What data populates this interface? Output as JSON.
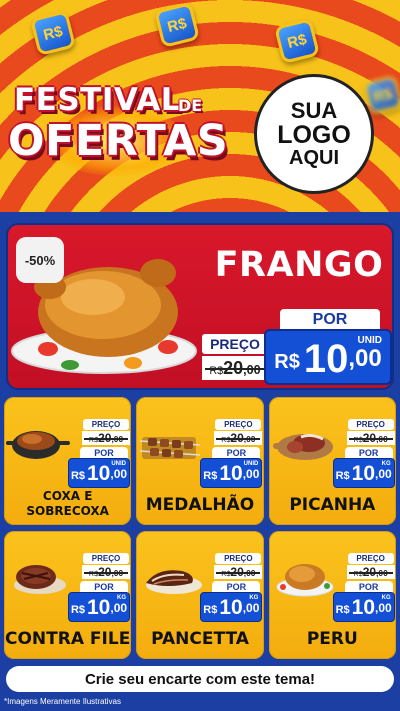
{
  "header": {
    "currency_symbol": "R$",
    "title_line1": "FESTIVAL",
    "title_connector": "DE",
    "title_line2": "OFERTAS",
    "logo": {
      "line1": "SUA",
      "line2": "LOGO",
      "line3": "AQUI"
    }
  },
  "featured": {
    "discount": "-50%",
    "name": "FRANGO",
    "preco_label": "PREÇO",
    "old_currency": "R$",
    "old_integer": "20",
    "old_cents": ",00",
    "por_label": "POR",
    "new_currency": "R$",
    "new_integer": "10",
    "new_cents": ",00",
    "unit": "UNID"
  },
  "products": [
    {
      "name": "COXA E SOBRECOXA",
      "preco_label": "PREÇO",
      "old_currency": "R$",
      "old_integer": "20",
      "old_cents": ",00",
      "por_label": "POR",
      "new_currency": "R$",
      "new_integer": "10",
      "new_cents": ",00",
      "unit": "UNID"
    },
    {
      "name": "MEDALHÃO",
      "preco_label": "PREÇO",
      "old_currency": "R$",
      "old_integer": "20",
      "old_cents": ",00",
      "por_label": "POR",
      "new_currency": "R$",
      "new_integer": "10",
      "new_cents": ",00",
      "unit": "UNID"
    },
    {
      "name": "PICANHA",
      "preco_label": "PREÇO",
      "old_currency": "R$",
      "old_integer": "20",
      "old_cents": ",00",
      "por_label": "POR",
      "new_currency": "R$",
      "new_integer": "10",
      "new_cents": ",00",
      "unit": "KG"
    },
    {
      "name": "CONTRA FILE",
      "preco_label": "PREÇO",
      "old_currency": "R$",
      "old_integer": "20",
      "old_cents": ",00",
      "por_label": "POR",
      "new_currency": "R$",
      "new_integer": "10",
      "new_cents": ",00",
      "unit": "KG"
    },
    {
      "name": "PANCETTA",
      "preco_label": "PREÇO",
      "old_currency": "R$",
      "old_integer": "20",
      "old_cents": ",00",
      "por_label": "POR",
      "new_currency": "R$",
      "new_integer": "10",
      "new_cents": ",00",
      "unit": "KG"
    },
    {
      "name": "PERU",
      "preco_label": "PREÇO",
      "old_currency": "R$",
      "old_integer": "20",
      "old_cents": ",00",
      "por_label": "POR",
      "new_currency": "R$",
      "new_integer": "10",
      "new_cents": ",00",
      "unit": "KG"
    }
  ],
  "cta": {
    "text": "Crie seu encarte com este tema!"
  },
  "disclaimer": "*Imagens Meramente Ilustrativas",
  "colors": {
    "background_blue": "#1b3fa3",
    "featured_red": "#d9182b",
    "card_yellow": "#fbc21c",
    "price_blue": "#1450d6"
  },
  "icons": [
    "coin-icon",
    "roast-chicken-image",
    "chicken-leg-pot-image",
    "skewers-image",
    "picanha-board-image",
    "steak-image",
    "pancetta-image",
    "roast-turkey-image"
  ]
}
